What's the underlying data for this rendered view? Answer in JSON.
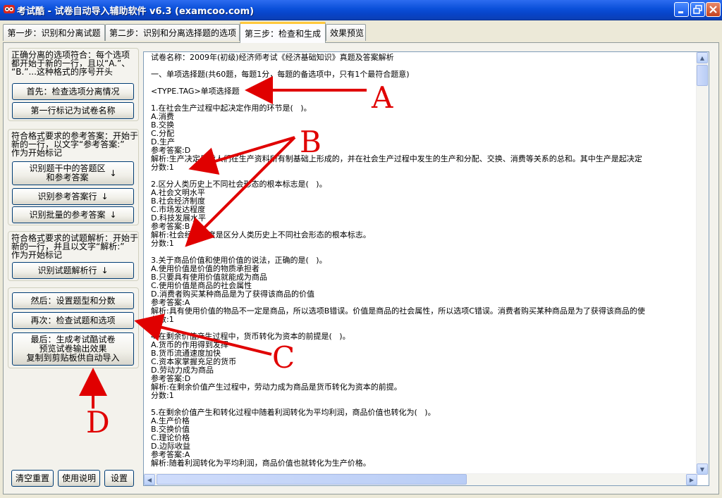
{
  "window": {
    "title": "考试酷 - 试卷自动导入辅助软件 v6.3 (examcoo.com)"
  },
  "tabs": [
    {
      "label": "第一步：识别和分离试题"
    },
    {
      "label": "第二步：识别和分离选择题的选项"
    },
    {
      "label": "第三步：检查和生成",
      "active": true
    },
    {
      "label": "效果预览"
    }
  ],
  "left": {
    "group1_text": "正确分离的选项符合：每个选项\n都开始于新的一行，且以“A.”、\n“B.”...这种格式的序号开头",
    "btn_check_options": "首先：检查选项分离情况",
    "btn_first_line_title": "第一行标记为试卷名称",
    "group2_text": "符合格式要求的参考答案：开始于\n新的一行，以文字“参考答案:”\n作为开始标记",
    "btn_identify_answer_area": "识别题干中的答题区\n和参考答案",
    "btn_identify_answer_line": "识别参考答案行",
    "btn_identify_batch_answers": "识别批量的参考答案",
    "group3_text": "符合格式要求的试题解析：开始于\n新的一行，并且以文字“解析:”\n作为开始标记",
    "btn_identify_explanation": "识别试题解析行",
    "btn_set_type_score": "然后：设置题型和分数",
    "btn_check_questions": "再次：检查试题和选项",
    "btn_generate": "最后：生成考试酷试卷\n预览试卷输出效果\n复制到剪贴板供自动导入",
    "btn_clear": "清空重置",
    "btn_help": "使用说明",
    "btn_settings": "设置",
    "down_arrow": "↓"
  },
  "content": {
    "text": "试卷名称：2009年(初级)经济师考试《经济基础知识》真题及答案解析\n\n一、单项选择题(共60题，每题1分，每题的备选项中，只有1个最符合题意)\n\n<TYPE.TAG>单项选择题\n\n1.在社会生产过程中起决定作用的环节是(   )。\nA.消费\nB.交换\nC.分配\nD.生产\n参考答案:D\n解析:生产决定是指人们在生产资料所有制基础上形成的，并在社会生产过程中发生的生产和分配、交换、消费等关系的总和。其中生产是起决定\n分数:1\n\n2.区分人类历史上不同社会形态的根本标志是(   )。\nA.社会文明水平\nB.社会经济制度\nC.市场发达程度\nD.科技发展水平\n参考答案:B\n解析:社会经济制度是区分人类历史上不同社会形态的根本标志。\n分数:1\n\n3.关于商品价值和使用价值的说法，正确的是(   )。\nA.使用价值是价值的物质承担者\nB.只要具有使用价值就能成为商品\nC.使用价值是商品的社会属性\nD.消费者购买某种商品是为了获得该商品的价值\n参考答案:A\n解析:具有使用价值的物品不一定是商品，所以选项B错误。价值是商品的社会属性，所以选项C错误。消费者购买某种商品是为了获得该商品的使\n分数:1\n\n4.在剩余价值产生过程中，货币转化为资本的前提是(   )。\nA.货币的作用得到发挥\nB.货币流通速度加快\nC.资本家掌握充足的货币\nD.劳动力成为商品\n参考答案:D\n解析:在剩余价值产生过程中，劳动力成为商品是货币转化为资本的前提。\n分数:1\n\n5.在剩余价值产生和转化过程中随着利润转化为平均利润，商品价值也转化为(   )。\nA.生产价格\nB.交换价值\nC.理论价格\nD.边际收益\n参考答案:A\n解析:随着利润转化为平均利润，商品价值也就转化为生产价格。"
  },
  "annotations": {
    "letters": [
      "A",
      "B",
      "C",
      "D"
    ],
    "color": "#e00000"
  },
  "colors": {
    "titlebar": "#0a4fd9",
    "tab_highlight": "#ffc83c",
    "button_border": "#003c74"
  }
}
